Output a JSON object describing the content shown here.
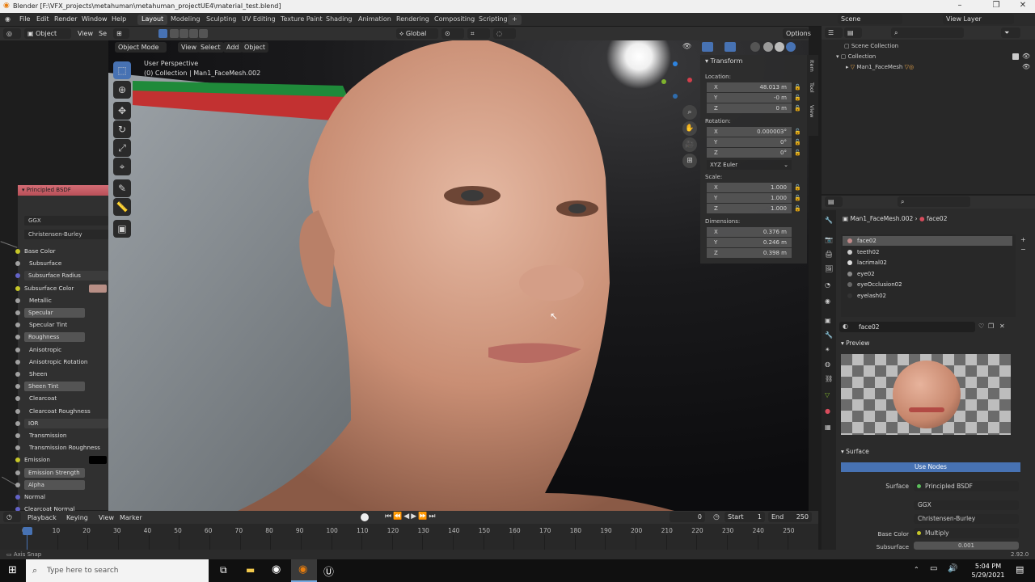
{
  "window": {
    "title": "Blender [F:\\VFX_projects\\metahuman\\metahuman_projectUE4\\material_test.blend]"
  },
  "menu": {
    "items": [
      "File",
      "Edit",
      "Render",
      "Window",
      "Help"
    ]
  },
  "workspaces": [
    "Layout",
    "Modeling",
    "Sculpting",
    "UV Editing",
    "Texture Paint",
    "Shading",
    "Animation",
    "Rendering",
    "Compositing",
    "Scripting"
  ],
  "active_workspace": "Layout",
  "scene": {
    "label": "Scene",
    "view_layer": "View Layer"
  },
  "node_header": {
    "mode": "Object",
    "view": "View",
    "select": "Se"
  },
  "node": {
    "title": "Principled BSDF",
    "distribution": "GGX",
    "subsurface_method": "Christensen-Burley",
    "inputs": [
      "Base Color",
      "Subsurface",
      "Subsurface Radius",
      "Subsurface Color",
      "Metallic",
      "Specular",
      "Specular Tint",
      "Roughness",
      "Anisotropic",
      "Anisotropic Rotation",
      "Sheen",
      "Sheen Tint",
      "Clearcoat",
      "Clearcoat Roughness",
      "IOR",
      "Transmission",
      "Transmission Roughness",
      "Emission",
      "Emission Strength",
      "Alpha",
      "Normal",
      "Clearcoat Normal"
    ]
  },
  "viewport": {
    "mode": "Object Mode",
    "menus": [
      "View",
      "Select",
      "Add",
      "Object"
    ],
    "orientation": "Global",
    "options": "Options",
    "perspective": "User Perspective",
    "collection_line": "(0) Collection | Man1_FaceMesh.002"
  },
  "transform": {
    "title": "Transform",
    "location_label": "Location:",
    "location": [
      {
        "axis": "X",
        "value": "48.013 m"
      },
      {
        "axis": "Y",
        "value": "-0 m"
      },
      {
        "axis": "Z",
        "value": "0 m"
      }
    ],
    "rotation_label": "Rotation:",
    "rotation": [
      {
        "axis": "X",
        "value": "0.000003°"
      },
      {
        "axis": "Y",
        "value": "0°"
      },
      {
        "axis": "Z",
        "value": "0°"
      }
    ],
    "rotation_mode": "XYZ Euler",
    "scale_label": "Scale:",
    "scale": [
      {
        "axis": "X",
        "value": "1.000"
      },
      {
        "axis": "Y",
        "value": "1.000"
      },
      {
        "axis": "Z",
        "value": "1.000"
      }
    ],
    "dimensions_label": "Dimensions:",
    "dimensions": [
      {
        "axis": "X",
        "value": "0.376 m"
      },
      {
        "axis": "Y",
        "value": "0.246 m"
      },
      {
        "axis": "Z",
        "value": "0.398 m"
      }
    ]
  },
  "sidebar_tabs": [
    "Item",
    "Tool",
    "View"
  ],
  "outliner": {
    "root": "Scene Collection",
    "collection": "Collection",
    "object": "Man1_FaceMesh"
  },
  "properties": {
    "object_name": "Man1_FaceMesh.002",
    "material_name": "face02",
    "slots": [
      "face02",
      "teeth02",
      "lacrimal02",
      "eye02",
      "eyeOcclusion02",
      "eyelash02"
    ],
    "preview_label": "Preview",
    "surface_label": "Surface",
    "use_nodes": "Use Nodes",
    "surface_field_label": "Surface",
    "surface_value": "Principled BSDF",
    "distribution": "GGX",
    "subsurface_method": "Christensen-Burley",
    "base_color_label": "Base Color",
    "base_color_value": "Multiply",
    "subsurface_label": "Subsurface",
    "subsurface_value": "0.001"
  },
  "timeline": {
    "menus": [
      "Playback",
      "Keying",
      "View",
      "Marker"
    ],
    "current_frame": "0",
    "start_label": "Start",
    "start": "1",
    "end_label": "End",
    "end": "250",
    "ticks": [
      "0",
      "10",
      "20",
      "30",
      "40",
      "50",
      "60",
      "70",
      "80",
      "90",
      "100",
      "110",
      "120",
      "130",
      "140",
      "150",
      "160",
      "170",
      "180",
      "190",
      "200",
      "210",
      "220",
      "230",
      "240",
      "250"
    ]
  },
  "status": {
    "left": "Axis Snap",
    "version": "2.92.0"
  },
  "taskbar": {
    "search_placeholder": "Type here to search",
    "time": "5:04 PM",
    "date": "5/29/2021"
  }
}
